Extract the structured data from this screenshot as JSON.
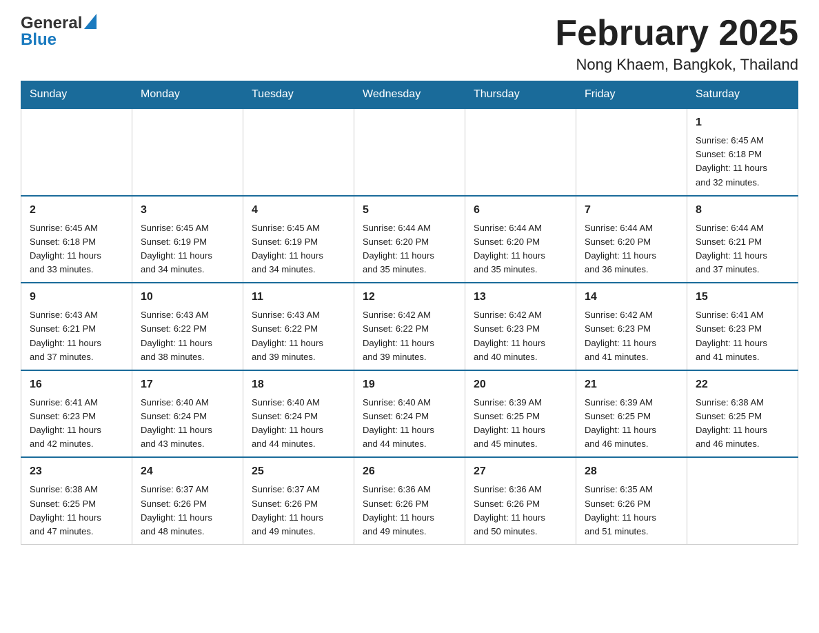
{
  "header": {
    "logo_general": "General",
    "logo_blue": "Blue",
    "month_title": "February 2025",
    "location": "Nong Khaem, Bangkok, Thailand"
  },
  "days_of_week": [
    "Sunday",
    "Monday",
    "Tuesday",
    "Wednesday",
    "Thursday",
    "Friday",
    "Saturday"
  ],
  "weeks": [
    {
      "days": [
        {
          "num": "",
          "info": ""
        },
        {
          "num": "",
          "info": ""
        },
        {
          "num": "",
          "info": ""
        },
        {
          "num": "",
          "info": ""
        },
        {
          "num": "",
          "info": ""
        },
        {
          "num": "",
          "info": ""
        },
        {
          "num": "1",
          "info": "Sunrise: 6:45 AM\nSunset: 6:18 PM\nDaylight: 11 hours\nand 32 minutes."
        }
      ]
    },
    {
      "days": [
        {
          "num": "2",
          "info": "Sunrise: 6:45 AM\nSunset: 6:18 PM\nDaylight: 11 hours\nand 33 minutes."
        },
        {
          "num": "3",
          "info": "Sunrise: 6:45 AM\nSunset: 6:19 PM\nDaylight: 11 hours\nand 34 minutes."
        },
        {
          "num": "4",
          "info": "Sunrise: 6:45 AM\nSunset: 6:19 PM\nDaylight: 11 hours\nand 34 minutes."
        },
        {
          "num": "5",
          "info": "Sunrise: 6:44 AM\nSunset: 6:20 PM\nDaylight: 11 hours\nand 35 minutes."
        },
        {
          "num": "6",
          "info": "Sunrise: 6:44 AM\nSunset: 6:20 PM\nDaylight: 11 hours\nand 35 minutes."
        },
        {
          "num": "7",
          "info": "Sunrise: 6:44 AM\nSunset: 6:20 PM\nDaylight: 11 hours\nand 36 minutes."
        },
        {
          "num": "8",
          "info": "Sunrise: 6:44 AM\nSunset: 6:21 PM\nDaylight: 11 hours\nand 37 minutes."
        }
      ]
    },
    {
      "days": [
        {
          "num": "9",
          "info": "Sunrise: 6:43 AM\nSunset: 6:21 PM\nDaylight: 11 hours\nand 37 minutes."
        },
        {
          "num": "10",
          "info": "Sunrise: 6:43 AM\nSunset: 6:22 PM\nDaylight: 11 hours\nand 38 minutes."
        },
        {
          "num": "11",
          "info": "Sunrise: 6:43 AM\nSunset: 6:22 PM\nDaylight: 11 hours\nand 39 minutes."
        },
        {
          "num": "12",
          "info": "Sunrise: 6:42 AM\nSunset: 6:22 PM\nDaylight: 11 hours\nand 39 minutes."
        },
        {
          "num": "13",
          "info": "Sunrise: 6:42 AM\nSunset: 6:23 PM\nDaylight: 11 hours\nand 40 minutes."
        },
        {
          "num": "14",
          "info": "Sunrise: 6:42 AM\nSunset: 6:23 PM\nDaylight: 11 hours\nand 41 minutes."
        },
        {
          "num": "15",
          "info": "Sunrise: 6:41 AM\nSunset: 6:23 PM\nDaylight: 11 hours\nand 41 minutes."
        }
      ]
    },
    {
      "days": [
        {
          "num": "16",
          "info": "Sunrise: 6:41 AM\nSunset: 6:23 PM\nDaylight: 11 hours\nand 42 minutes."
        },
        {
          "num": "17",
          "info": "Sunrise: 6:40 AM\nSunset: 6:24 PM\nDaylight: 11 hours\nand 43 minutes."
        },
        {
          "num": "18",
          "info": "Sunrise: 6:40 AM\nSunset: 6:24 PM\nDaylight: 11 hours\nand 44 minutes."
        },
        {
          "num": "19",
          "info": "Sunrise: 6:40 AM\nSunset: 6:24 PM\nDaylight: 11 hours\nand 44 minutes."
        },
        {
          "num": "20",
          "info": "Sunrise: 6:39 AM\nSunset: 6:25 PM\nDaylight: 11 hours\nand 45 minutes."
        },
        {
          "num": "21",
          "info": "Sunrise: 6:39 AM\nSunset: 6:25 PM\nDaylight: 11 hours\nand 46 minutes."
        },
        {
          "num": "22",
          "info": "Sunrise: 6:38 AM\nSunset: 6:25 PM\nDaylight: 11 hours\nand 46 minutes."
        }
      ]
    },
    {
      "days": [
        {
          "num": "23",
          "info": "Sunrise: 6:38 AM\nSunset: 6:25 PM\nDaylight: 11 hours\nand 47 minutes."
        },
        {
          "num": "24",
          "info": "Sunrise: 6:37 AM\nSunset: 6:26 PM\nDaylight: 11 hours\nand 48 minutes."
        },
        {
          "num": "25",
          "info": "Sunrise: 6:37 AM\nSunset: 6:26 PM\nDaylight: 11 hours\nand 49 minutes."
        },
        {
          "num": "26",
          "info": "Sunrise: 6:36 AM\nSunset: 6:26 PM\nDaylight: 11 hours\nand 49 minutes."
        },
        {
          "num": "27",
          "info": "Sunrise: 6:36 AM\nSunset: 6:26 PM\nDaylight: 11 hours\nand 50 minutes."
        },
        {
          "num": "28",
          "info": "Sunrise: 6:35 AM\nSunset: 6:26 PM\nDaylight: 11 hours\nand 51 minutes."
        },
        {
          "num": "",
          "info": ""
        }
      ]
    }
  ]
}
